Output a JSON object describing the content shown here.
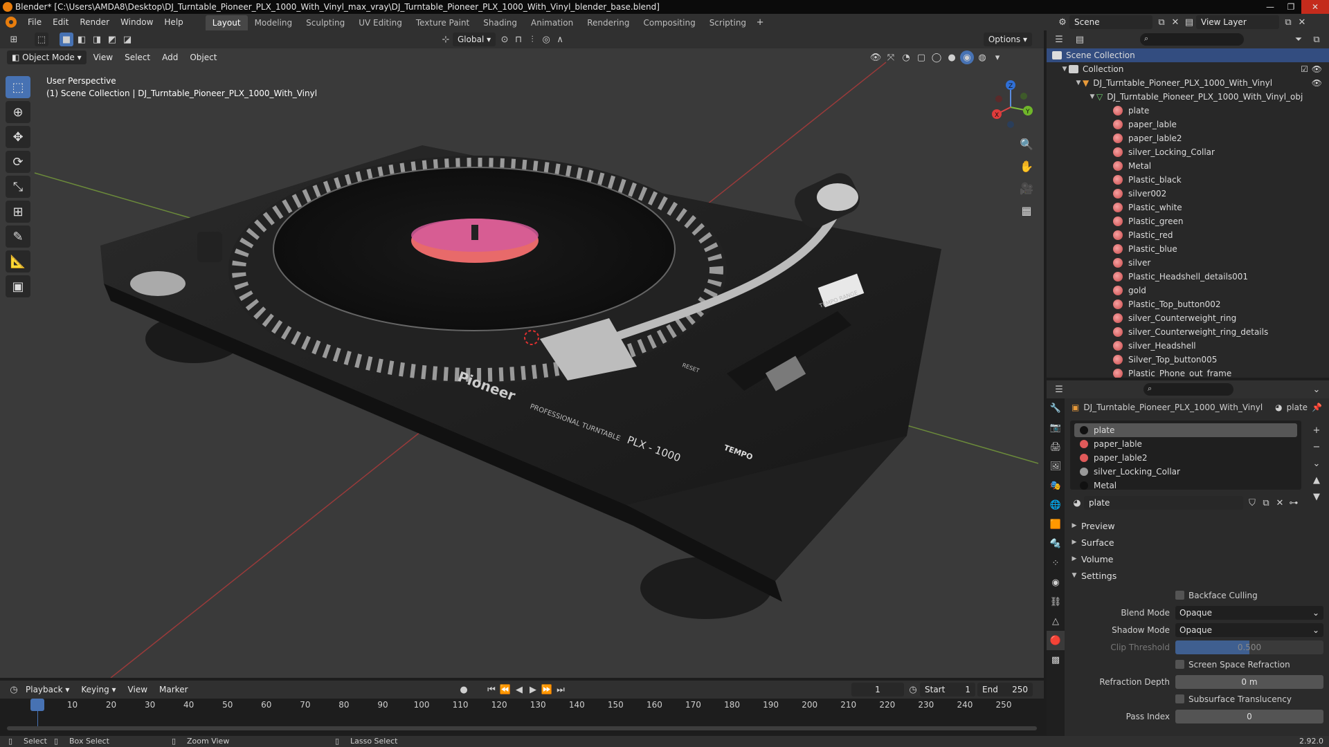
{
  "title": "Blender* [C:\\Users\\AMDA8\\Desktop\\DJ_Turntable_Pioneer_PLX_1000_With_Vinyl_max_vray\\DJ_Turntable_Pioneer_PLX_1000_With_Vinyl_blender_base.blend]",
  "menu": [
    "File",
    "Edit",
    "Render",
    "Window",
    "Help"
  ],
  "workspaces": [
    "Layout",
    "Modeling",
    "Sculpting",
    "UV Editing",
    "Texture Paint",
    "Shading",
    "Animation",
    "Rendering",
    "Compositing",
    "Scripting"
  ],
  "scene": "Scene",
  "view_layer": "View Layer",
  "header": {
    "orientation": "Global",
    "options": "Options"
  },
  "vp_menu": {
    "mode": "Object Mode",
    "items": [
      "View",
      "Select",
      "Add",
      "Object"
    ]
  },
  "vp_info": {
    "line1": "User Perspective",
    "line2": "(1) Scene Collection | DJ_Turntable_Pioneer_PLX_1000_With_Vinyl"
  },
  "gizmo": {
    "x": "X",
    "y": "Y",
    "z": "Z"
  },
  "render": {
    "brand": "Pioneer",
    "subtitle": "PROFESSIONAL TURNTABLE",
    "model": "PLX - 1000",
    "tempo": "TEMPO",
    "reset": "RESET",
    "tempo_range": "TEMPO RANGE"
  },
  "outliner": {
    "scene_collection": "Scene Collection",
    "collection": "Collection",
    "object": "DJ_Turntable_Pioneer_PLX_1000_With_Vinyl",
    "mesh": "DJ_Turntable_Pioneer_PLX_1000_With_Vinyl_obj",
    "materials": [
      "plate",
      "paper_lable",
      "paper_lable2",
      "silver_Locking_Collar",
      "Metal",
      "Plastic_black",
      "silver002",
      "Plastic_white",
      "Plastic_green",
      "Plastic_red",
      "Plastic_blue",
      "silver",
      "Plastic_Headshell_details001",
      "gold",
      "Plastic_Top_button002",
      "silver_Counterweight_ring",
      "silver_Counterweight_ring_details",
      "silver_Headshell",
      "Silver_Top_button005",
      "Plastic_Phone_out_frame"
    ]
  },
  "props": {
    "object": "DJ_Turntable_Pioneer_PLX_1000_With_Vinyl",
    "material": "plate",
    "slots": [
      "plate",
      "paper_lable",
      "paper_lable2",
      "silver_Locking_Collar",
      "Metal"
    ],
    "material_name": "plate",
    "panels": [
      "Preview",
      "Surface",
      "Volume",
      "Settings"
    ],
    "backface": "Backface Culling",
    "blend_mode_label": "Blend Mode",
    "blend_mode": "Opaque",
    "shadow_mode_label": "Shadow Mode",
    "shadow_mode": "Opaque",
    "clip_label": "Clip Threshold",
    "clip": "0.500",
    "ssr": "Screen Space Refraction",
    "refraction_label": "Refraction Depth",
    "refraction": "0 m",
    "sss": "Subsurface Translucency",
    "pass_label": "Pass Index",
    "pass": "0"
  },
  "timeline": {
    "menus": [
      "Playback",
      "Keying",
      "View",
      "Marker"
    ],
    "current": "1",
    "start_label": "Start",
    "start": "1",
    "end_label": "End",
    "end": "250",
    "ticks": [
      "1",
      "10",
      "20",
      "30",
      "40",
      "50",
      "60",
      "70",
      "80",
      "90",
      "100",
      "110",
      "120",
      "130",
      "140",
      "150",
      "160",
      "170",
      "180",
      "190",
      "200",
      "210",
      "220",
      "230",
      "240",
      "250"
    ]
  },
  "status": {
    "select": "Select",
    "box_select": "Box Select",
    "zoom": "Zoom View",
    "lasso": "Lasso Select",
    "version": "2.92.0"
  }
}
